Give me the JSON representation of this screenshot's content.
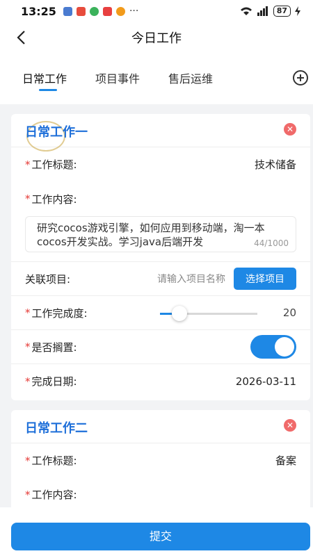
{
  "status_bar": {
    "time": "13:25",
    "more": "···",
    "battery": "87"
  },
  "header": {
    "title": "今日工作"
  },
  "tabs": [
    {
      "label": "日常工作",
      "active": true
    },
    {
      "label": "项目事件",
      "active": false
    },
    {
      "label": "售后运维",
      "active": false
    }
  ],
  "cards": [
    {
      "title": "日常工作一",
      "fields": {
        "title_label": "工作标题:",
        "title_value": "技术储备",
        "content_label": "工作内容:",
        "content_value": "研究cocos游戏引擎，如何应用到移动端，淘一本cocos开发实战。学习java后端开发",
        "content_counter": "44/1000",
        "project_label": "关联项目:",
        "project_placeholder": "请输入项目名称",
        "project_button": "选择项目",
        "progress_label": "工作完成度:",
        "progress_value": "20",
        "shelved_label": "是否搁置:",
        "shelved_on": true,
        "date_label": "完成日期:",
        "date_value": "2026-03-11"
      }
    },
    {
      "title": "日常工作二",
      "fields": {
        "title_label": "工作标题:",
        "title_value": "备案",
        "content_label": "工作内容:"
      }
    }
  ],
  "required_mark": "*",
  "submit_label": "提交",
  "colors": {
    "accent": "#1e88e5",
    "close": "#f06a6a",
    "required": "#e53935"
  }
}
